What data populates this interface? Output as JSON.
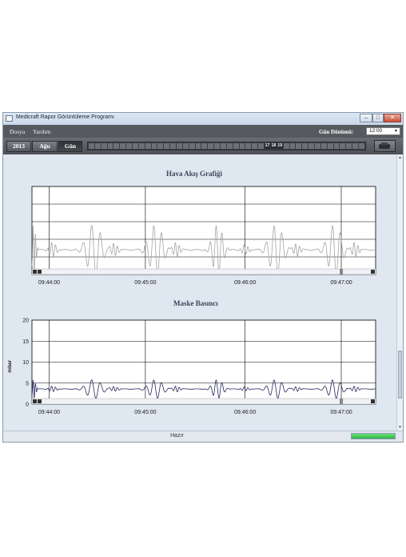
{
  "window": {
    "title": "Medicraft Rapor Görüntüleme Programı"
  },
  "menu": {
    "items": [
      "Dosya",
      "Yardım"
    ]
  },
  "toolbar": {
    "gun_donumu_label": "Gün Dönümü:",
    "gun_donumu_value": "12:00",
    "year_button": "2013",
    "week_button": "Ağu",
    "day_button": "Gün",
    "highlighted_days": [
      "17",
      "18",
      "19"
    ]
  },
  "status": {
    "text": "Hazır",
    "progress": 1.0
  },
  "colors": {
    "airflow_line": "#a3a3a3",
    "mask_line": "#26265e",
    "grid": "#000000",
    "menubar": "#565a5f"
  },
  "chart_data": [
    {
      "type": "line",
      "title": "Hava Akış Grafiği",
      "xlabel": "",
      "ylabel": "",
      "x_tick_labels": [
        "09:44:00",
        "09:45:00",
        "09:46:00",
        "09:47:00"
      ],
      "y_tick_labels": [],
      "grid": true,
      "series": [
        {
          "values": []
        }
      ]
    },
    {
      "type": "line",
      "title": "Maske Basıncı",
      "xlabel": "",
      "ylabel": "mbar",
      "x_tick_labels": [
        "09:44:00",
        "09:45:00",
        "09:46:00",
        "09:47:00"
      ],
      "y_tick_labels": [
        "0",
        "5",
        "10",
        "15",
        "20"
      ],
      "ylim": [
        0,
        20
      ],
      "grid": true,
      "series": [
        {
          "values": []
        }
      ]
    }
  ]
}
